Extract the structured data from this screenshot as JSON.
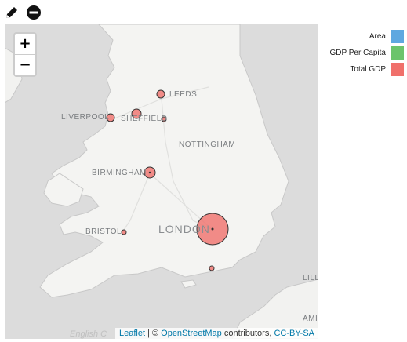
{
  "toolbar": {
    "edit_icon": "pencil-icon",
    "remove_icon": "minus-circle-icon"
  },
  "zoom": {
    "in_label": "+",
    "out_label": "−"
  },
  "map": {
    "cities": {
      "leeds": "LEEDS",
      "liverpool": "LIVERPOOL",
      "sheffield": "SHEFFIELD",
      "nottingham": "NOTTINGHAM",
      "birmingham": "BIRMINGHAM",
      "london": "LONDON",
      "bristol": "BRISTOL",
      "lille": "LILLE",
      "amiens": "AMI"
    },
    "english_channel": "English C",
    "marker_color": "#f0706b"
  },
  "attribution": {
    "leaflet": "Leaflet",
    "sep": " | © ",
    "osm": "OpenStreetMap",
    "contributors": " contributors, ",
    "license": "CC-BY-SA"
  },
  "legend": {
    "items": [
      {
        "label": "Area",
        "color": "#5fa8e0"
      },
      {
        "label": "GDP Per Capita",
        "color": "#6cc46c"
      },
      {
        "label": "Total GDP",
        "color": "#f0706b"
      }
    ]
  }
}
